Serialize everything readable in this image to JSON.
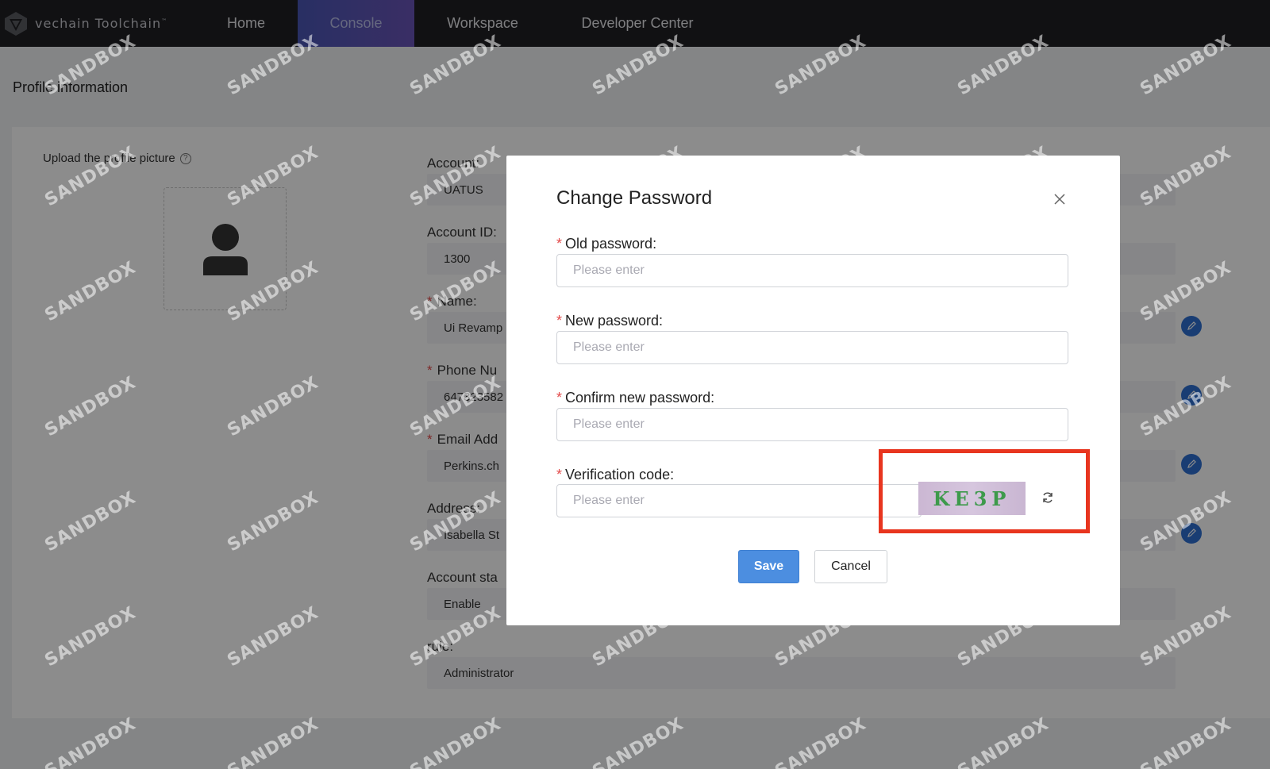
{
  "nav": {
    "brand": "vechain Toolchain",
    "brand_tm": "™",
    "items": [
      {
        "label": "Home"
      },
      {
        "label": "Console"
      },
      {
        "label": "Workspace"
      },
      {
        "label": "Developer Center"
      }
    ],
    "active": "Console"
  },
  "page": {
    "title": "Profile information",
    "upload_label": "Upload the profile picture",
    "fields": [
      {
        "label": "Account:",
        "value": "UATUS",
        "required": false
      },
      {
        "label": "Account ID:",
        "value": "1300",
        "required": false
      },
      {
        "label": "Name:",
        "value": "Ui Revamp",
        "required": true
      },
      {
        "label": "Phone Nu",
        "value": "647323582",
        "required": true
      },
      {
        "label": "Email Add",
        "value": "Perkins.ch",
        "required": true
      },
      {
        "label": "Address:",
        "value": "Isabella St",
        "required": false
      },
      {
        "label": "Account sta",
        "value": "Enable",
        "required": false
      },
      {
        "label": "rule:",
        "value": "Administrator",
        "required": false
      }
    ]
  },
  "watermark": "SANDBOX",
  "modal": {
    "title": "Change Password",
    "fields": [
      {
        "label": "Old password:",
        "placeholder": "Please enter"
      },
      {
        "label": "New password:",
        "placeholder": "Please enter"
      },
      {
        "label": "Confirm new password:",
        "placeholder": "Please enter"
      },
      {
        "label": "Verification code:",
        "placeholder": "Please enter"
      }
    ],
    "captcha_text": "KE3P",
    "required_mark": "*",
    "save_label": "Save",
    "cancel_label": "Cancel"
  },
  "colors": {
    "nav_bg": "#1f2024",
    "accent": "#4c8ee0",
    "required": "#e34b4b",
    "highlight": "#e8351f"
  }
}
